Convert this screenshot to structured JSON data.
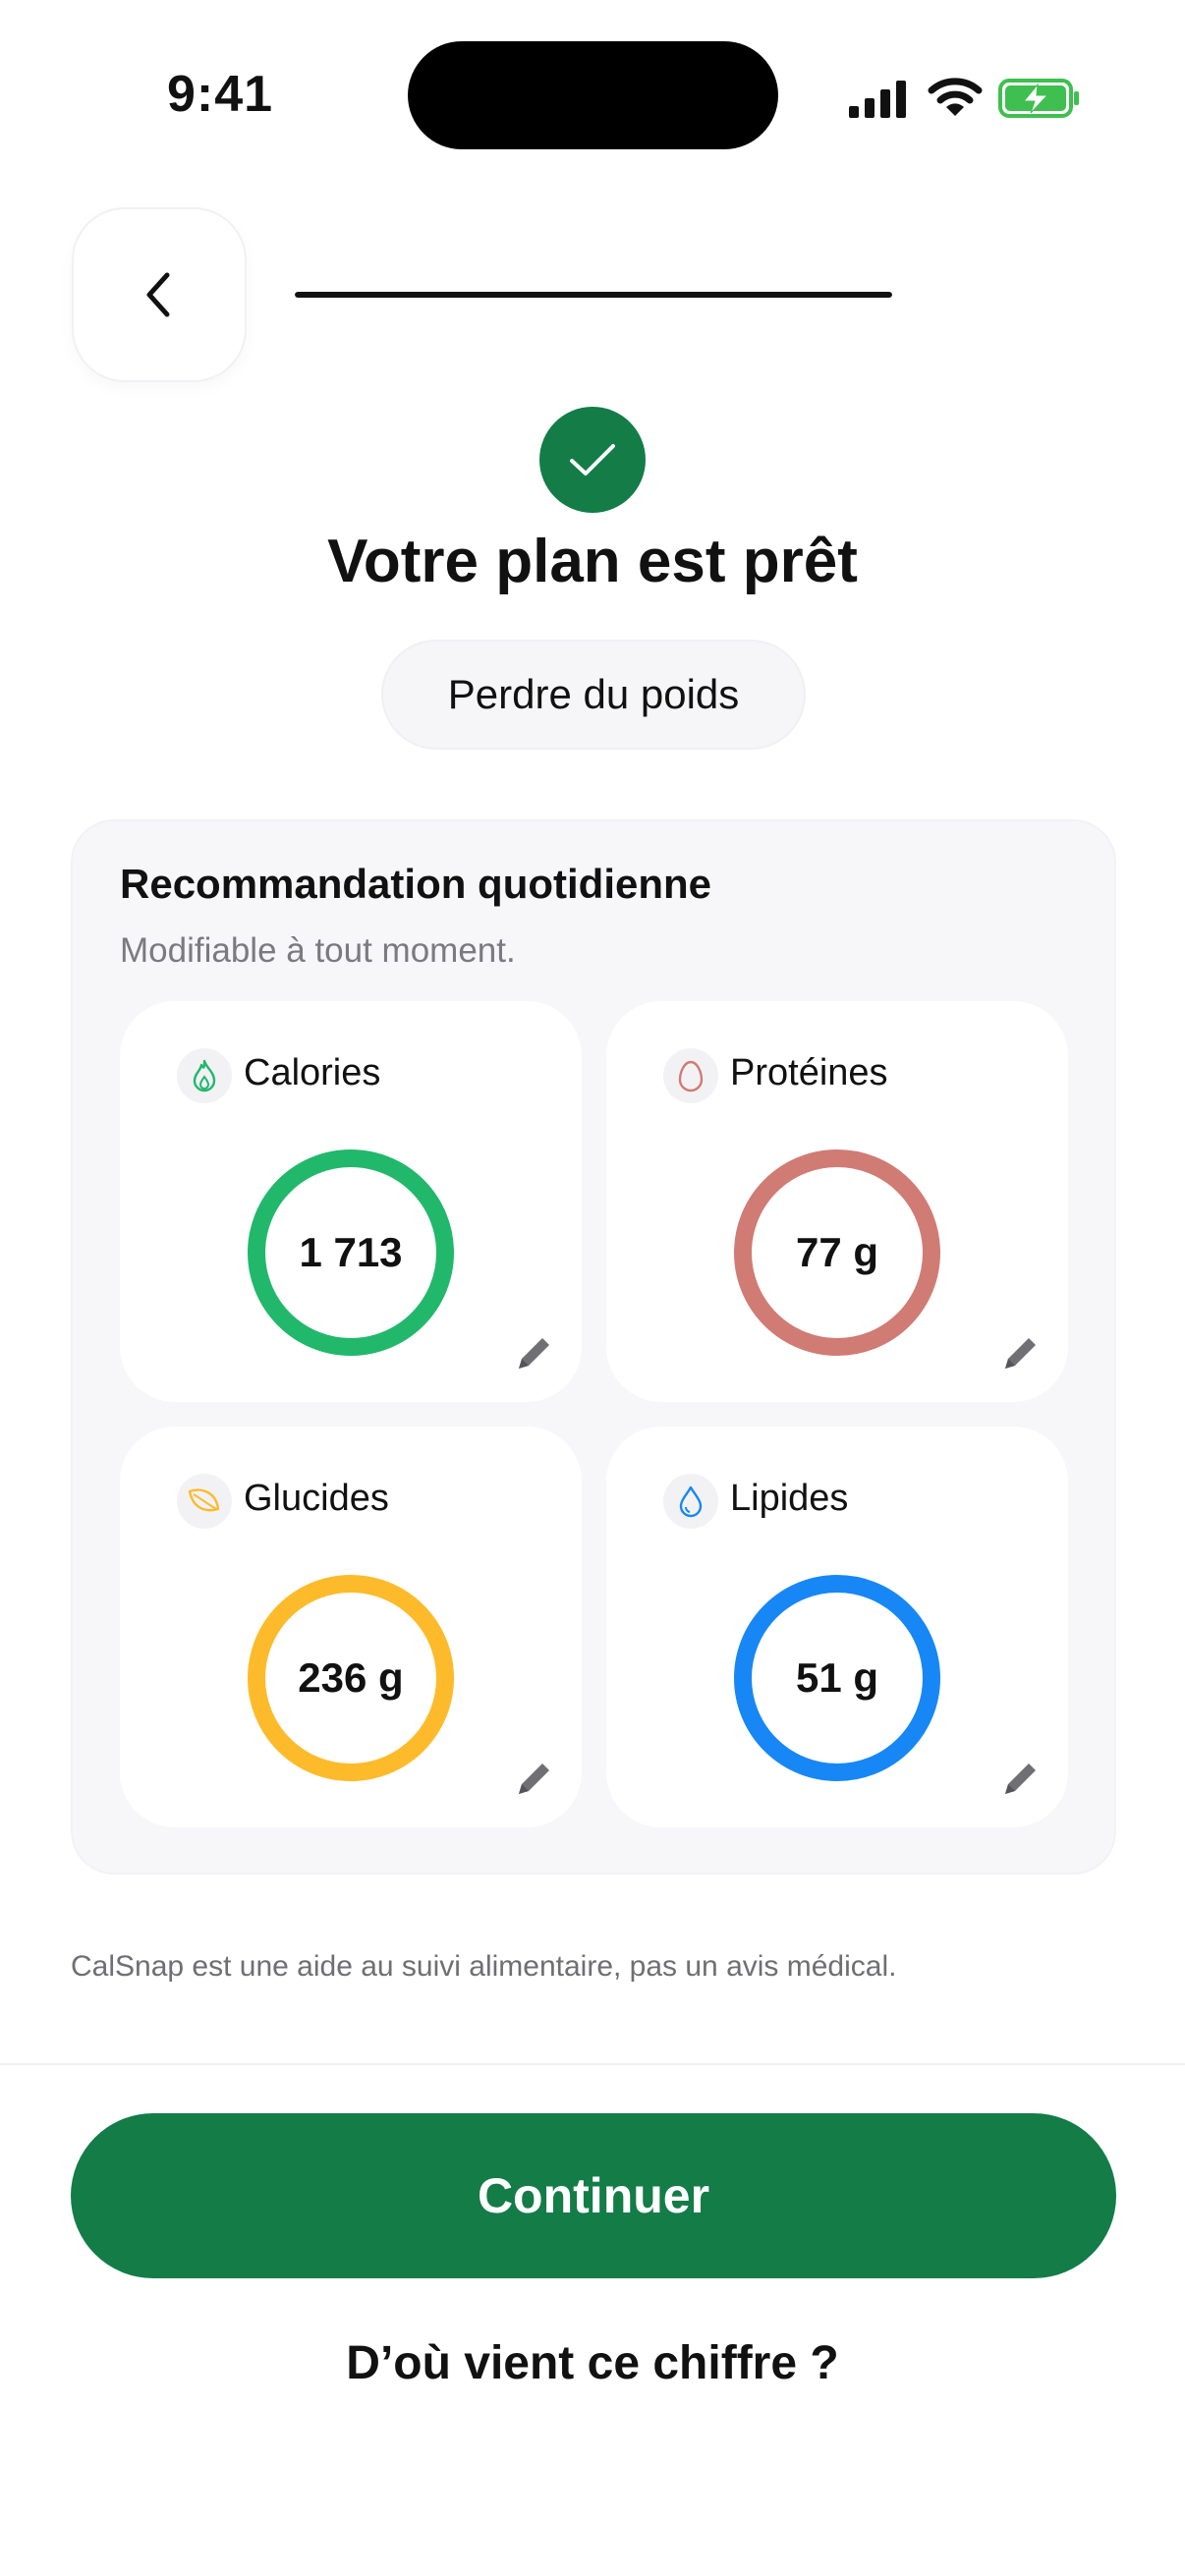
{
  "status_bar": {
    "time": "9:41"
  },
  "nav": {
    "progress_fraction": 1.0
  },
  "header": {
    "title": "Votre plan est prêt",
    "goal": "Perdre du poids"
  },
  "recommendation": {
    "title": "Recommandation quotidienne",
    "subtitle": "Modifiable à tout moment.",
    "macros": [
      {
        "label": "Calories",
        "value": "1 713",
        "color": "#21b86c",
        "icon": "flame-icon"
      },
      {
        "label": "Protéines",
        "value": "77 g",
        "color": "#d07b74",
        "icon": "egg-icon"
      },
      {
        "label": "Glucides",
        "value": "236 g",
        "color": "#fdbb2b",
        "icon": "leaf-icon"
      },
      {
        "label": "Lipides",
        "value": "51 g",
        "color": "#1787f5",
        "icon": "drop-icon"
      }
    ]
  },
  "disclaimer": "CalSnap est une aide au suivi alimentaire, pas un avis médical.",
  "actions": {
    "continue_label": "Continuer",
    "info_label": "D’où vient ce chiffre ?"
  },
  "colors": {
    "brand_green": "#137c47",
    "card_bg": "#f7f7fa"
  }
}
